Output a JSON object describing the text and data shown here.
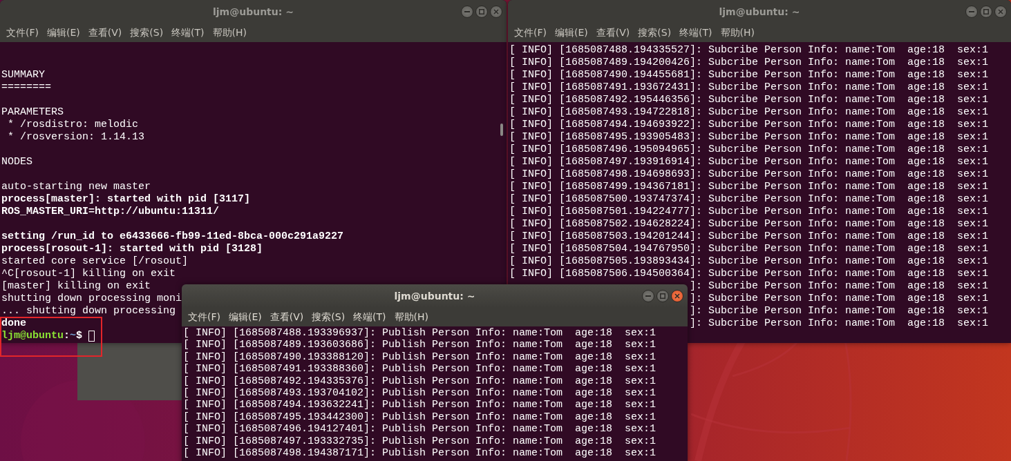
{
  "windows": [
    {
      "title": "ljm@ubuntu: ~",
      "active": false,
      "menu": [
        "文件(F)",
        "编辑(E)",
        "查看(V)",
        "搜索(S)",
        "终端(T)",
        "帮助(H)"
      ],
      "lines": [
        {
          "kind": "blank"
        },
        {
          "kind": "blank"
        },
        {
          "kind": "text",
          "text": "SUMMARY",
          "bold": false
        },
        {
          "kind": "text",
          "text": "========",
          "bold": false
        },
        {
          "kind": "blank"
        },
        {
          "kind": "text",
          "text": "PARAMETERS",
          "bold": false
        },
        {
          "kind": "text",
          "text": " * /rosdistro: melodic",
          "bold": false
        },
        {
          "kind": "text",
          "text": " * /rosversion: 1.14.13",
          "bold": false
        },
        {
          "kind": "blank"
        },
        {
          "kind": "text",
          "text": "NODES",
          "bold": false
        },
        {
          "kind": "blank"
        },
        {
          "kind": "text",
          "text": "auto-starting new master",
          "bold": false
        },
        {
          "kind": "text",
          "text": "process[master]: started with pid [3117]",
          "bold": true
        },
        {
          "kind": "text",
          "text": "ROS_MASTER_URI=http://ubuntu:11311/",
          "bold": true
        },
        {
          "kind": "blank"
        },
        {
          "kind": "text",
          "text": "setting /run_id to e6433666-fb99-11ed-8bca-000c291a9227",
          "bold": true
        },
        {
          "kind": "text",
          "text": "process[rosout-1]: started with pid [3128]",
          "bold": true
        },
        {
          "kind": "text",
          "text": "started core service [/rosout]",
          "bold": false
        },
        {
          "kind": "text",
          "text": "^C[rosout-1] killing on exit",
          "bold": false
        },
        {
          "kind": "text",
          "text": "[master] killing on exit",
          "bold": false
        },
        {
          "kind": "text",
          "text": "shutting down processing moni",
          "bold": false
        },
        {
          "kind": "text",
          "text": "... shutting down processing",
          "bold": false
        },
        {
          "kind": "text",
          "text": "done",
          "bold": true
        },
        {
          "kind": "prompt",
          "user": "ljm@ubuntu",
          "separator": ":",
          "path": "~",
          "symbol": "$"
        }
      ]
    },
    {
      "title": "ljm@ubuntu: ~",
      "active": false,
      "menu": [
        "文件(F)",
        "编辑(E)",
        "查看(V)",
        "搜索(S)",
        "终端(T)",
        "帮助(H)"
      ],
      "lines": [
        {
          "kind": "text",
          "text": "[ INFO] [1685087488.194335527]: Subcribe Person Info: name:Tom  age:18  sex:1"
        },
        {
          "kind": "text",
          "text": "[ INFO] [1685087489.194200426]: Subcribe Person Info: name:Tom  age:18  sex:1"
        },
        {
          "kind": "text",
          "text": "[ INFO] [1685087490.194455681]: Subcribe Person Info: name:Tom  age:18  sex:1"
        },
        {
          "kind": "text",
          "text": "[ INFO] [1685087491.193672431]: Subcribe Person Info: name:Tom  age:18  sex:1"
        },
        {
          "kind": "text",
          "text": "[ INFO] [1685087492.195446356]: Subcribe Person Info: name:Tom  age:18  sex:1"
        },
        {
          "kind": "text",
          "text": "[ INFO] [1685087493.194722818]: Subcribe Person Info: name:Tom  age:18  sex:1"
        },
        {
          "kind": "text",
          "text": "[ INFO] [1685087494.194693922]: Subcribe Person Info: name:Tom  age:18  sex:1"
        },
        {
          "kind": "text",
          "text": "[ INFO] [1685087495.193905483]: Subcribe Person Info: name:Tom  age:18  sex:1"
        },
        {
          "kind": "text",
          "text": "[ INFO] [1685087496.195094965]: Subcribe Person Info: name:Tom  age:18  sex:1"
        },
        {
          "kind": "text",
          "text": "[ INFO] [1685087497.193916914]: Subcribe Person Info: name:Tom  age:18  sex:1"
        },
        {
          "kind": "text",
          "text": "[ INFO] [1685087498.194698693]: Subcribe Person Info: name:Tom  age:18  sex:1"
        },
        {
          "kind": "text",
          "text": "[ INFO] [1685087499.194367181]: Subcribe Person Info: name:Tom  age:18  sex:1"
        },
        {
          "kind": "text",
          "text": "[ INFO] [1685087500.193747374]: Subcribe Person Info: name:Tom  age:18  sex:1"
        },
        {
          "kind": "text",
          "text": "[ INFO] [1685087501.194224777]: Subcribe Person Info: name:Tom  age:18  sex:1"
        },
        {
          "kind": "text",
          "text": "[ INFO] [1685087502.194628224]: Subcribe Person Info: name:Tom  age:18  sex:1"
        },
        {
          "kind": "text",
          "text": "[ INFO] [1685087503.194201244]: Subcribe Person Info: name:Tom  age:18  sex:1"
        },
        {
          "kind": "text",
          "text": "[ INFO] [1685087504.194767950]: Subcribe Person Info: name:Tom  age:18  sex:1"
        },
        {
          "kind": "text",
          "text": "[ INFO] [1685087505.193893434]: Subcribe Person Info: name:Tom  age:18  sex:1"
        },
        {
          "kind": "text",
          "text": "[ INFO] [1685087506.194500364]: Subcribe Person Info: name:Tom  age:18  sex:1"
        },
        {
          "kind": "partial",
          "text": "]: Subcribe Person Info: name:Tom  age:18  sex:1"
        },
        {
          "kind": "partial",
          "text": "]: Subcribe Person Info: name:Tom  age:18  sex:1"
        },
        {
          "kind": "partial",
          "text": "]: Subcribe Person Info: name:Tom  age:18  sex:1"
        },
        {
          "kind": "partial",
          "text": "]: Subcribe Person Info: name:Tom  age:18  sex:1"
        }
      ]
    },
    {
      "title": "ljm@ubuntu: ~",
      "active": true,
      "menu": [
        "文件(F)",
        "编辑(E)",
        "查看(V)",
        "搜索(S)",
        "终端(T)",
        "帮助(H)"
      ],
      "lines": [
        {
          "kind": "text",
          "text": "[ INFO] [1685087488.193396937]: Publish Person Info: name:Tom  age:18  sex:1"
        },
        {
          "kind": "text",
          "text": "[ INFO] [1685087489.193603686]: Publish Person Info: name:Tom  age:18  sex:1"
        },
        {
          "kind": "text",
          "text": "[ INFO] [1685087490.193388120]: Publish Person Info: name:Tom  age:18  sex:1"
        },
        {
          "kind": "text",
          "text": "[ INFO] [1685087491.193388360]: Publish Person Info: name:Tom  age:18  sex:1"
        },
        {
          "kind": "text",
          "text": "[ INFO] [1685087492.194335376]: Publish Person Info: name:Tom  age:18  sex:1"
        },
        {
          "kind": "text",
          "text": "[ INFO] [1685087493.193704102]: Publish Person Info: name:Tom  age:18  sex:1"
        },
        {
          "kind": "text",
          "text": "[ INFO] [1685087494.193632241]: Publish Person Info: name:Tom  age:18  sex:1"
        },
        {
          "kind": "text",
          "text": "[ INFO] [1685087495.193442300]: Publish Person Info: name:Tom  age:18  sex:1"
        },
        {
          "kind": "text",
          "text": "[ INFO] [1685087496.194127401]: Publish Person Info: name:Tom  age:18  sex:1"
        },
        {
          "kind": "text",
          "text": "[ INFO] [1685087497.193332735]: Publish Person Info: name:Tom  age:18  sex:1"
        },
        {
          "kind": "text",
          "text": "[ INFO] [1685087498.194387171]: Publish Person Info: name:Tom  age:18  sex:1"
        }
      ]
    }
  ]
}
